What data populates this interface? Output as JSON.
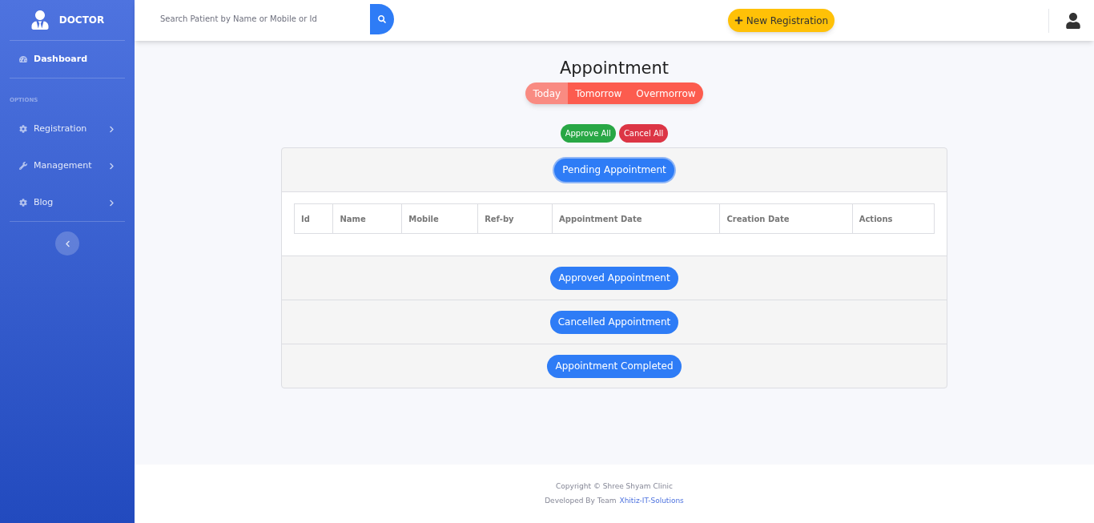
{
  "sidebar": {
    "brand": "DOCTOR",
    "items": [
      {
        "label": "Dashboard",
        "selected": true
      }
    ],
    "section_label": "OPTIONS",
    "option_items": [
      {
        "label": "Registration",
        "selected": false
      },
      {
        "label": "Management",
        "selected": false
      },
      {
        "label": "Blog",
        "selected": false
      }
    ]
  },
  "header": {
    "search": {
      "placeholder": "Search Patient by Name or Mobile or Id"
    },
    "new_button": "New Registration"
  },
  "page": {
    "title": "Appointment",
    "tabs": [
      {
        "label": "Today",
        "selected": true
      },
      {
        "label": "Tomorrow",
        "selected": false
      },
      {
        "label": "Overmorrow",
        "selected": false
      }
    ],
    "bulk_actions": [
      {
        "label": "Approve All",
        "kind": "approve"
      },
      {
        "label": "Cancel All",
        "kind": "cancel"
      }
    ],
    "sections": [
      {
        "title": "Pending Appointment",
        "expanded": true,
        "columns": [
          "Id",
          "Name",
          "Mobile",
          "Ref-by",
          "Appointment Date",
          "Creation Date",
          "Actions"
        ]
      },
      {
        "title": "Approved Appointment",
        "expanded": false
      },
      {
        "title": "Cancelled Appointment",
        "expanded": false
      },
      {
        "title": "Appointment Completed",
        "expanded": false
      }
    ]
  },
  "footer": {
    "copyright": "Copyright © Shree Shyam Clinic",
    "developed_by": "Developed By Team",
    "developer": "Xhitiz-IT-Solutions"
  }
}
